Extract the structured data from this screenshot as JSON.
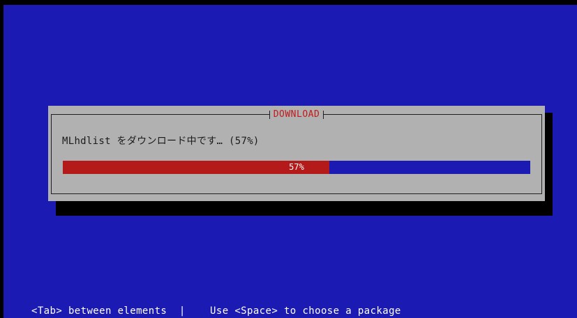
{
  "dialog": {
    "title": "DOWNLOAD",
    "message": "MLhdlist をダウンロード中です… (57%)",
    "progress_fraction": 0.57,
    "progress_label": "57%"
  },
  "statusbar": {
    "help_text": "<Tab> between elements  |    Use <Space> to choose a package"
  },
  "colors": {
    "background": "#1b1bb3",
    "dialog_bg": "#b1b1b1",
    "title": "#c21a1a",
    "progress_fill": "#b41a1a",
    "progress_track": "#1b1bb3"
  }
}
